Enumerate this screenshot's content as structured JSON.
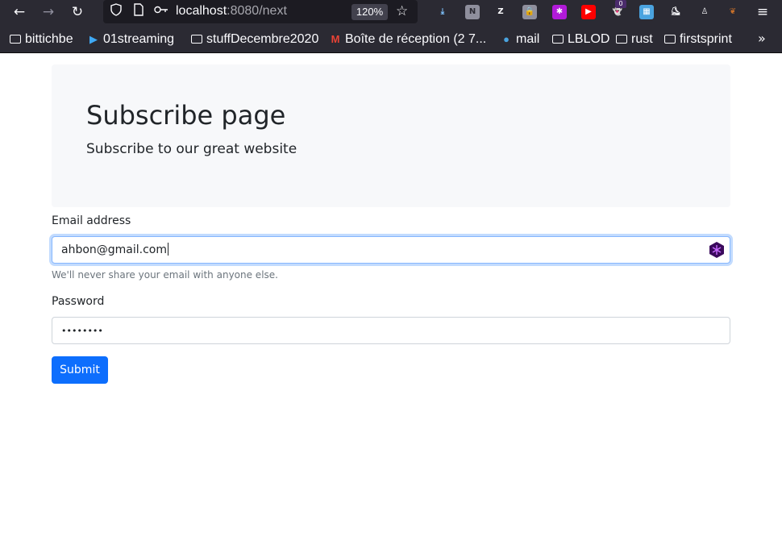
{
  "browser": {
    "url_host": "localhost",
    "url_rest": ":8080/next",
    "zoom": "120%",
    "icons": {
      "back": "arrow-left-icon",
      "forward": "arrow-right-icon",
      "reload": "reload-icon",
      "shield": "shield-icon",
      "page": "page-icon",
      "key": "key-icon",
      "star": "star-icon",
      "menu": "hamburger-menu-icon"
    },
    "extensions": [
      {
        "name": "download-icon",
        "glyph": "⤓",
        "bg": "transparent",
        "color": "#80c4ff"
      },
      {
        "name": "n-extension-icon",
        "glyph": "N",
        "bg": "#8f8f9d",
        "color": "#2b2a33"
      },
      {
        "name": "zotero-icon",
        "glyph": "Z",
        "bg": "transparent",
        "color": "#fbfbfe"
      },
      {
        "name": "lock-extension-icon",
        "glyph": "🔒",
        "bg": "#8f8f9d",
        "color": "#2b2a33"
      },
      {
        "name": "hex-extension-icon",
        "glyph": "✱",
        "bg": "#b11ad9",
        "color": "#fbfbfe"
      },
      {
        "name": "youtube-icon",
        "glyph": "▶",
        "bg": "#ff0000",
        "color": "#ffffff"
      },
      {
        "name": "ghost-extension-icon",
        "glyph": "👻",
        "bg": "transparent",
        "color": "#fbfbfe"
      },
      {
        "name": "windows-extension-icon",
        "glyph": "▦",
        "bg": "#4aa3df",
        "color": "#ffffff"
      },
      {
        "name": "shoe-extension-icon",
        "glyph": "⛸",
        "bg": "transparent",
        "color": "#fbfbfe"
      },
      {
        "name": "person-extension-icon",
        "glyph": "♙",
        "bg": "transparent",
        "color": "#fbfbfe"
      },
      {
        "name": "leaf-extension-icon",
        "glyph": "❦",
        "bg": "transparent",
        "color": "#c8702a"
      }
    ],
    "badge_count": "0",
    "bookmarks": [
      {
        "label": "bittichbe",
        "type": "folder"
      },
      {
        "label": "01streaming",
        "type": "site",
        "icon": "play-icon"
      },
      {
        "label": "stuffDecembre2020",
        "type": "folder"
      },
      {
        "label": "Boîte de réception (2 7...",
        "type": "site",
        "icon": "gmail-icon"
      },
      {
        "label": "mail",
        "type": "site",
        "icon": "mail-icon"
      },
      {
        "label": "LBLOD",
        "type": "folder"
      },
      {
        "label": "rust",
        "type": "folder"
      },
      {
        "label": "firstsprint",
        "type": "folder"
      }
    ]
  },
  "page": {
    "title": "Subscribe page",
    "subtitle": "Subscribe to our great website",
    "email": {
      "label": "Email address",
      "value": "ahbon@gmail.com",
      "help": "We'll never share your email with anyone else."
    },
    "password": {
      "label": "Password",
      "value": "••••••••"
    },
    "submit_label": "Submit",
    "colors": {
      "primary": "#0d6efd",
      "jumbotron_bg": "#f7f8fa",
      "focus_border": "#86b7fe"
    }
  }
}
